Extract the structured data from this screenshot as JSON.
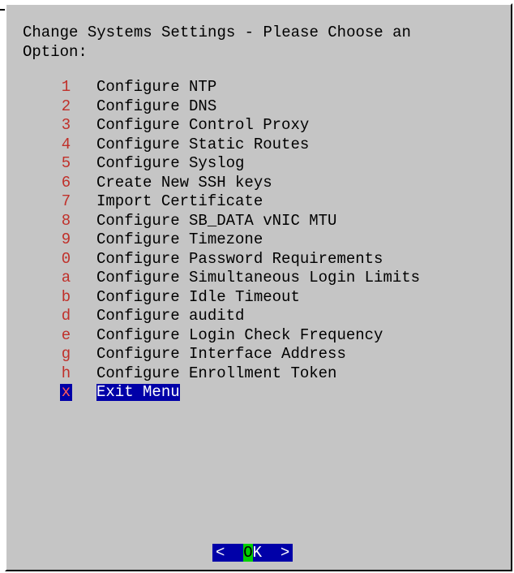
{
  "dialog": {
    "title": "Change Systems Settings - Please Choose an\nOption:"
  },
  "menu": {
    "items": [
      {
        "key": "1",
        "label": "Configure NTP"
      },
      {
        "key": "2",
        "label": "Configure DNS"
      },
      {
        "key": "3",
        "label": "Configure Control Proxy"
      },
      {
        "key": "4",
        "label": "Configure Static Routes"
      },
      {
        "key": "5",
        "label": "Configure Syslog"
      },
      {
        "key": "6",
        "label": "Create New SSH keys"
      },
      {
        "key": "7",
        "label": "Import Certificate"
      },
      {
        "key": "8",
        "label": "Configure SB_DATA vNIC MTU"
      },
      {
        "key": "9",
        "label": "Configure Timezone"
      },
      {
        "key": "0",
        "label": "Configure Password Requirements"
      },
      {
        "key": "a",
        "label": "Configure Simultaneous Login Limits"
      },
      {
        "key": "b",
        "label": "Configure Idle Timeout"
      },
      {
        "key": "d",
        "label": "Configure auditd"
      },
      {
        "key": "e",
        "label": "Configure Login Check Frequency"
      },
      {
        "key": "g",
        "label": "Configure Interface Address"
      },
      {
        "key": "h",
        "label": "Configure Enrollment Token"
      },
      {
        "key": "x",
        "label": "Exit Menu"
      }
    ],
    "selected_index": 16
  },
  "buttons": {
    "ok": {
      "left": "<  ",
      "hot": "O",
      "rest": "K  >"
    }
  },
  "colors": {
    "dialog_bg": "#c5c5c5",
    "hotkey": "#c0302a",
    "selection_bg": "#0000a8",
    "selection_fg": "#ffffff",
    "button_hotkey_bg": "#00d000"
  }
}
